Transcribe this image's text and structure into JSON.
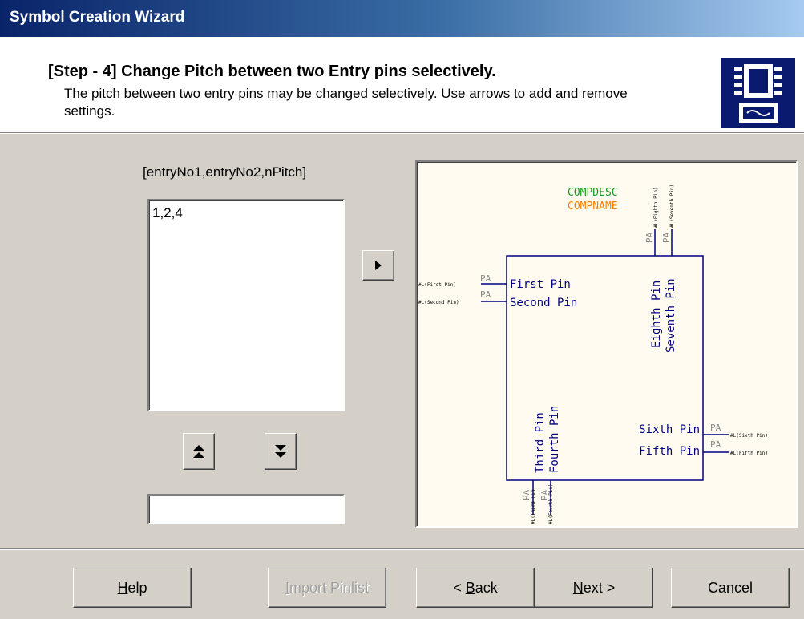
{
  "window": {
    "title": "Symbol Creation Wizard"
  },
  "header": {
    "title": "[Step - 4] Change Pitch between two Entry pins selectively.",
    "description": "The pitch between two entry pins may be changed selectively. Use arrows to add and remove settings."
  },
  "pitch_list": {
    "column_label": "[entryNo1,entryNo2,nPitch]",
    "items": [
      "1,2,4"
    ]
  },
  "entry_field": {
    "value": ""
  },
  "preview": {
    "comp_desc": "COMPDESC",
    "comp_name": "COMPNAME",
    "pin_type_label": "PA",
    "left_pins": [
      "First Pin",
      "Second Pin"
    ],
    "left_pin_refs": [
      "#L(First Pin)",
      "#L(Second Pin)"
    ],
    "top_pins": [
      "Eighth Pin",
      "Seventh Pin"
    ],
    "top_pin_refs": [
      "#L(Eighth Pin)",
      "#L(Seventh Pin)"
    ],
    "bottom_pins": [
      "Third Pin",
      "Fourth Pin"
    ],
    "bottom_pin_refs": [
      "#L(Third Pin)",
      "#L(Fourth Pin)"
    ],
    "right_pins": [
      "Sixth Pin",
      "Fifth Pin"
    ],
    "right_pin_refs": [
      "#L(Sixth Pin)",
      "#L(Fifth Pin)"
    ],
    "colors": {
      "desc": "#1a9a1a",
      "name": "#ff8000",
      "body": "#000080",
      "pa": "#8a8a8a"
    }
  },
  "icons": {
    "add": "play-right-icon",
    "move_up": "double-up-arrow-icon",
    "move_down": "double-down-arrow-icon",
    "header": "chip-icon"
  },
  "buttons": {
    "help_mnemonic": "H",
    "help_rest": "elp",
    "import_mnemonic": "I",
    "import_rest": "mport Pinlist",
    "back_prefix": "< ",
    "back_mnemonic": "B",
    "back_rest": "ack",
    "next_mnemonic": "N",
    "next_rest": "ext >",
    "cancel": "Cancel"
  }
}
